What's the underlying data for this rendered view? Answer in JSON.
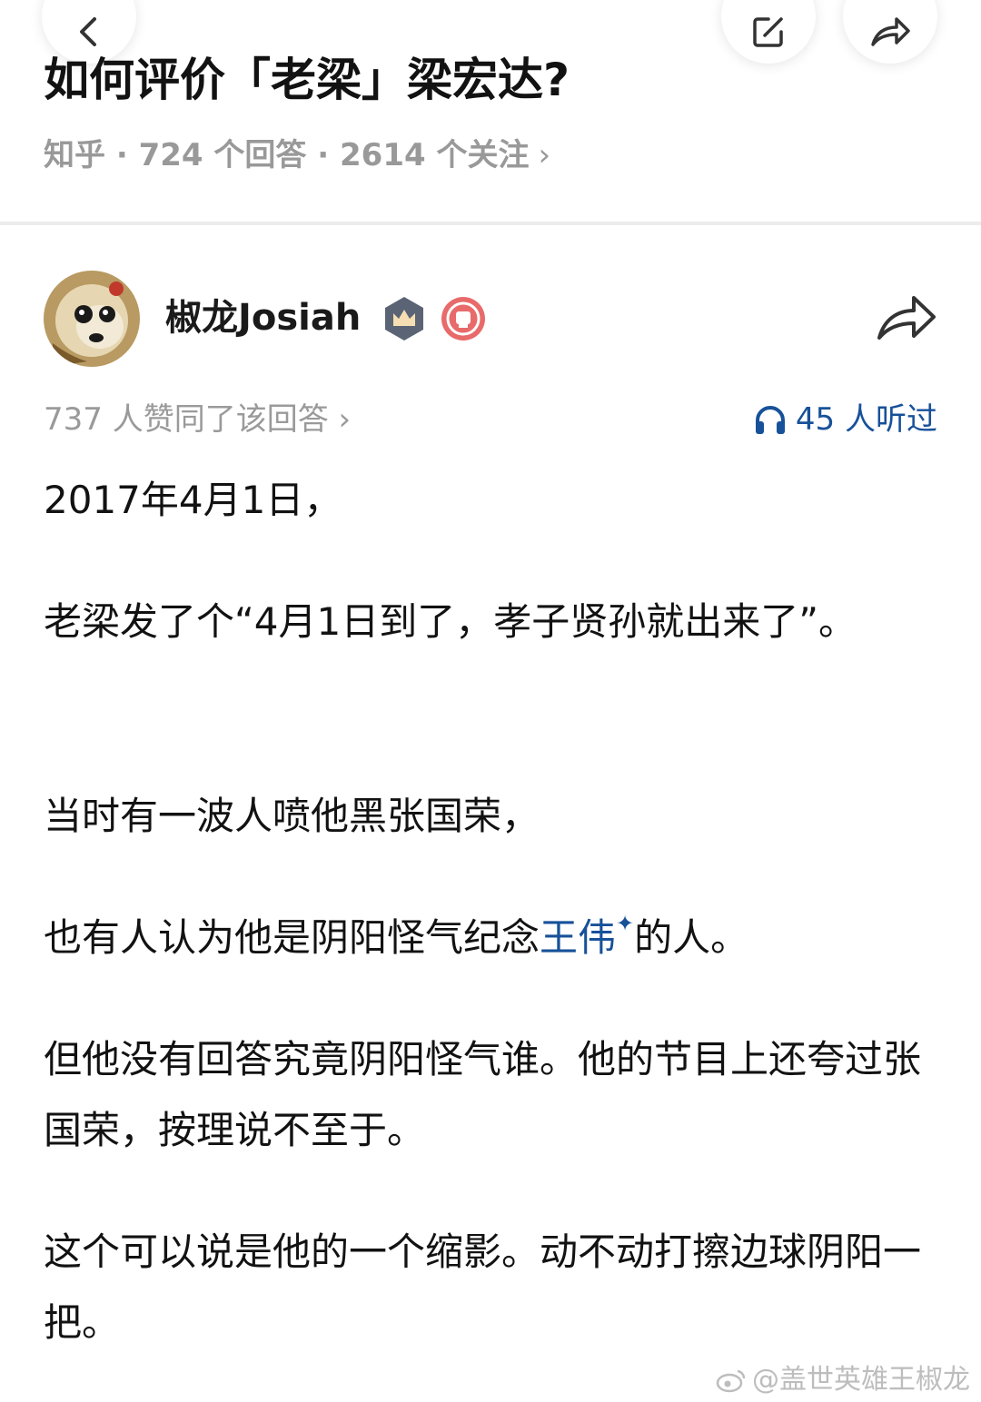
{
  "question": {
    "title": "如何评价「老梁」梁宏达?",
    "source": "知乎",
    "answers": "724 个回答",
    "follows": "2614 个关注",
    "separator": " · ",
    "chevron": "›"
  },
  "author": {
    "name": "椒龙Josiah",
    "badges": [
      "crown-badge-icon",
      "circle-badge-icon"
    ]
  },
  "stats": {
    "votes": "737 人赞同了该回答 ›",
    "listens": "45 人听过"
  },
  "body": {
    "p1": "2017年4月1日，",
    "p2": "老梁发了个“4月1日到了，孝子贤孙就出来了”。",
    "p3": "当时有一波人喷他黑张国荣，",
    "p4_before": "也有人认为他是阴阳怪气纪念",
    "p4_link": "王伟",
    "p4_spark": "✦",
    "p4_after": "的人。",
    "p5": "但他没有回答究竟阴阳怪气谁。他的节目上还夸过张国荣，按理说不至于。",
    "p6": "这个可以说是他的一个缩影。动不动打擦边球阴阳一把。"
  },
  "watermark": "@盖世英雄王椒龙",
  "colors": {
    "link": "#175199",
    "muted": "#999999",
    "text": "#121212"
  }
}
